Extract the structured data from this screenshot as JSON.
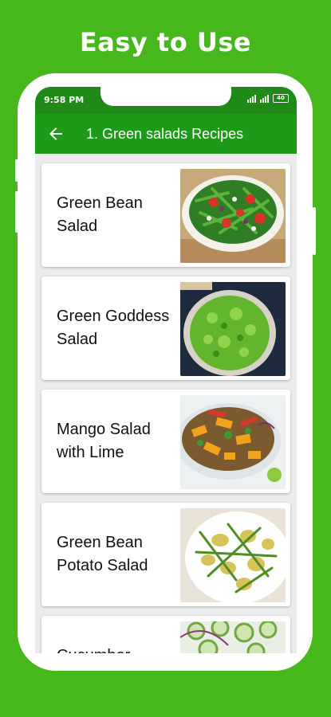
{
  "promo": {
    "title": "Easy to Use"
  },
  "status_bar": {
    "time": "9:58 PM",
    "battery": "40"
  },
  "app_bar": {
    "back_icon": "arrow-left-icon",
    "title": "1. Green salads Recipes"
  },
  "recipes": [
    {
      "title": "Green Bean\nSalad",
      "image": "green-bean-salad-photo"
    },
    {
      "title": "Green Goddess\nSalad",
      "image": "green-goddess-salad-photo"
    },
    {
      "title": "Mango Salad\nwith Lime",
      "image": "mango-salad-photo"
    },
    {
      "title": "Green Bean\nPotato Salad",
      "image": "green-bean-potato-salad-photo"
    },
    {
      "title": "Cucumber",
      "image": "cucumber-salad-photo"
    }
  ],
  "colors": {
    "background": "#47b81c",
    "status_bar": "#1f8a17",
    "app_bar": "#1d9a18"
  }
}
